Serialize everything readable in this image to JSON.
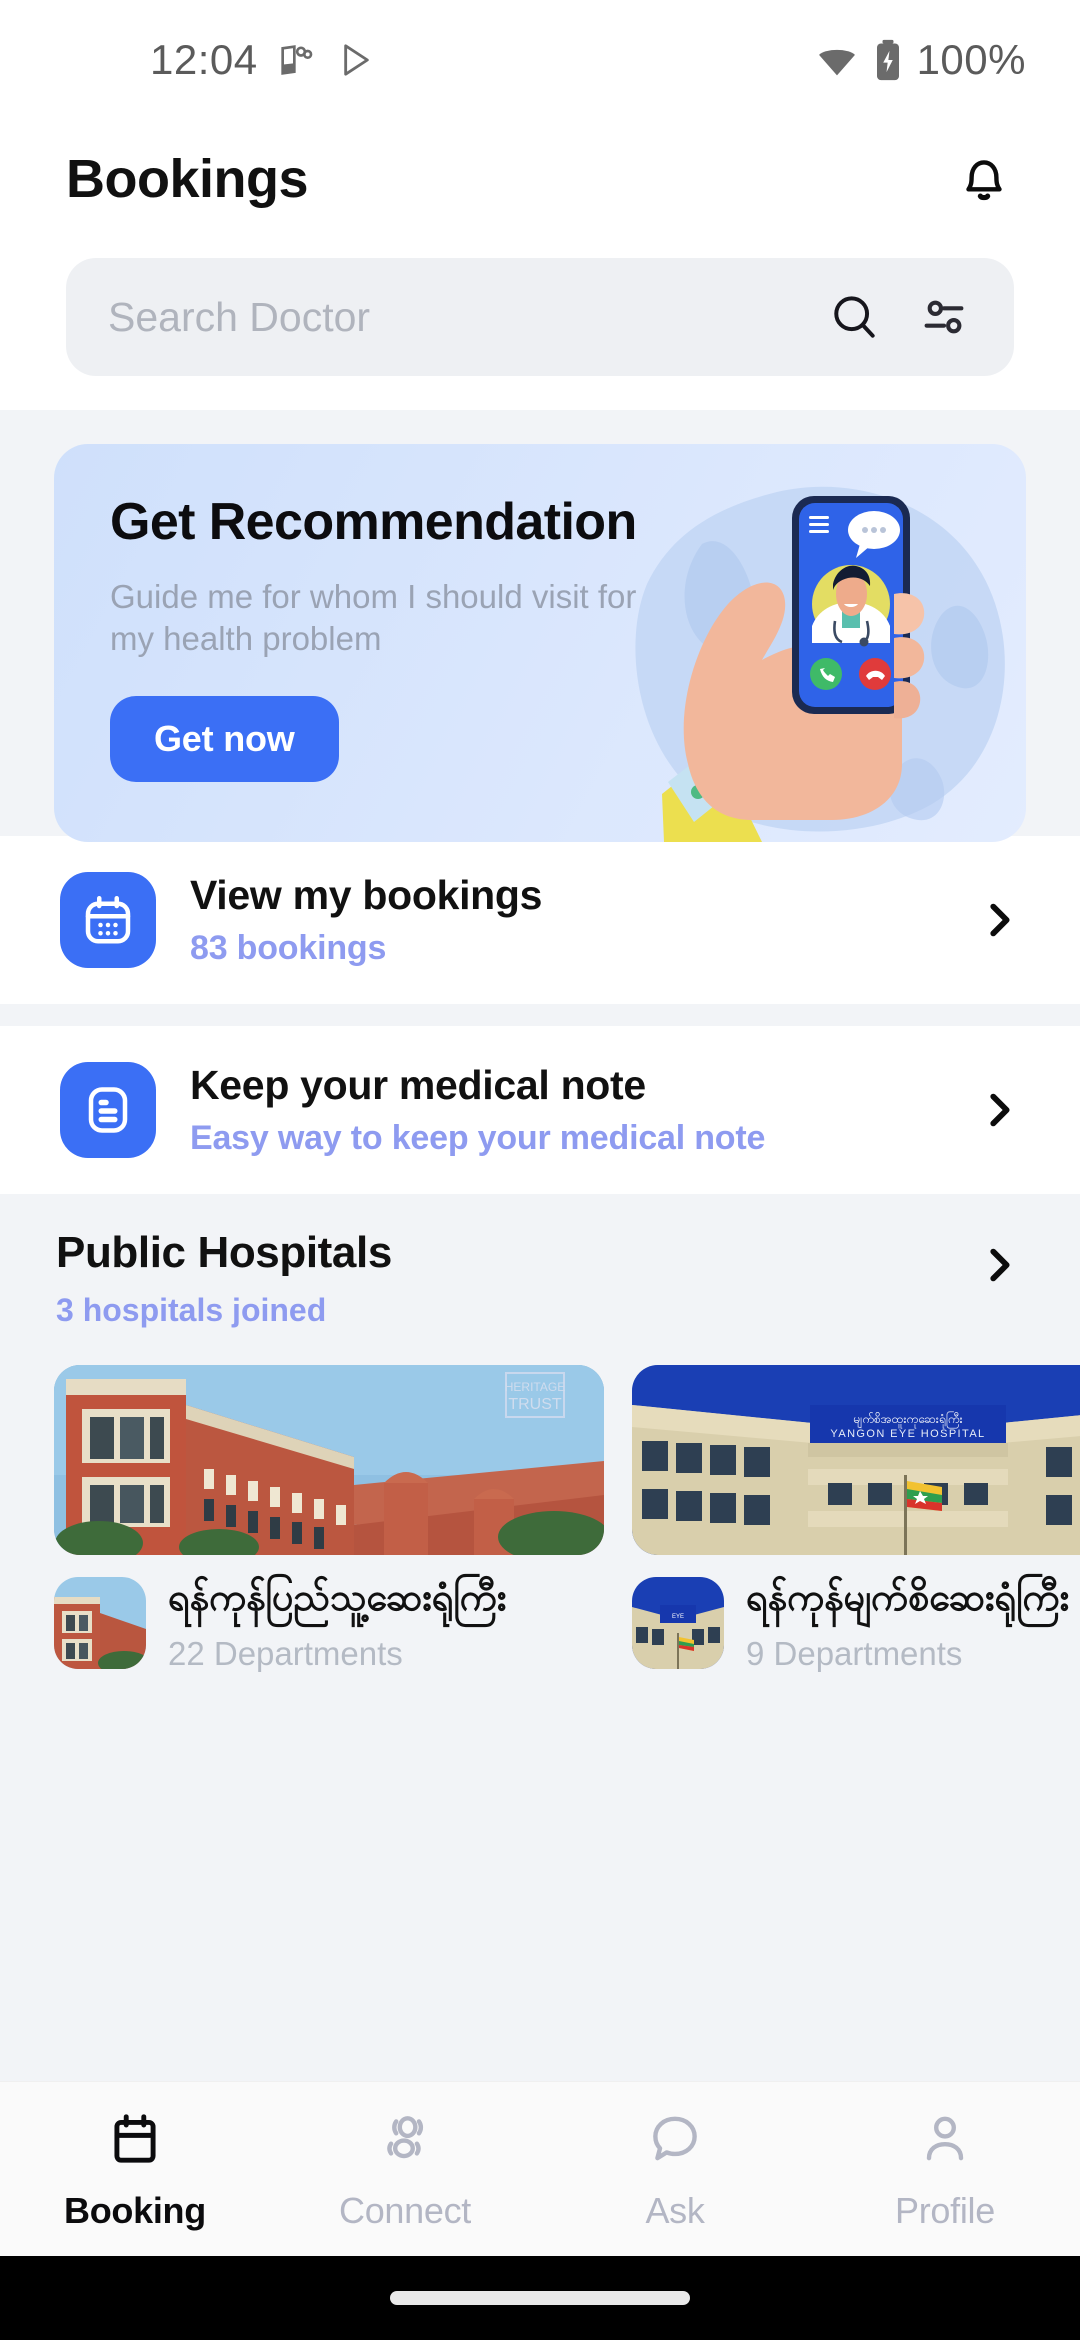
{
  "status_bar": {
    "time": "12:04",
    "battery_percent": "100%",
    "icons": [
      "book-app-icon",
      "play-store-icon",
      "wifi-icon",
      "battery-charging-icon"
    ]
  },
  "header": {
    "title": "Bookings",
    "notification_icon": "bell-icon"
  },
  "search": {
    "placeholder": "Search Doctor",
    "value": "",
    "search_icon": "search-icon",
    "filter_icon": "filter-tune-icon"
  },
  "banner": {
    "title": "Get Recommendation",
    "subtitle": "Guide me for whom I should visit for my health problem",
    "button_label": "Get now",
    "illustration": "hand-holding-phone-video-call-doctor"
  },
  "rows": [
    {
      "title": "View my bookings",
      "subtitle": "83 bookings",
      "icon": "calendar-icon",
      "chevron": "chevron-right-icon"
    },
    {
      "title": "Keep your medical note",
      "subtitle": "Easy way to keep your medical note",
      "icon": "document-note-icon",
      "chevron": "chevron-right-icon"
    }
  ],
  "hospitals_section": {
    "title": "Public Hospitals",
    "subtitle": "3 hospitals joined",
    "chevron": "chevron-right-icon",
    "cards": [
      {
        "name": "ရန်ကုန်ပြည်သူ့ဆေးရုံကြီး",
        "departments": "22 Departments",
        "photo": "yangon-general-hospital-red-brick-building",
        "watermark": "HERITAGE TRUST"
      },
      {
        "name": "ရန်ကုန်မျက်စိဆေးရုံကြီး",
        "departments": "9 Departments",
        "photo": "yangon-eye-hospital-building",
        "sign_text": "YANGON EYE HOSPITAL"
      }
    ]
  },
  "bottom_nav": {
    "items": [
      {
        "label": "Booking",
        "icon": "calendar-icon",
        "active": true
      },
      {
        "label": "Connect",
        "icon": "people-group-icon",
        "active": false
      },
      {
        "label": "Ask",
        "icon": "chat-bubble-icon",
        "active": false
      },
      {
        "label": "Profile",
        "icon": "person-icon",
        "active": false
      }
    ]
  },
  "colors": {
    "accent_blue": "#3b6ff5",
    "subtitle_violet": "#8e9bf0",
    "page_grey": "#f2f4f7",
    "search_grey": "#eef0f3",
    "nav_inactive": "#b3b6c4"
  }
}
